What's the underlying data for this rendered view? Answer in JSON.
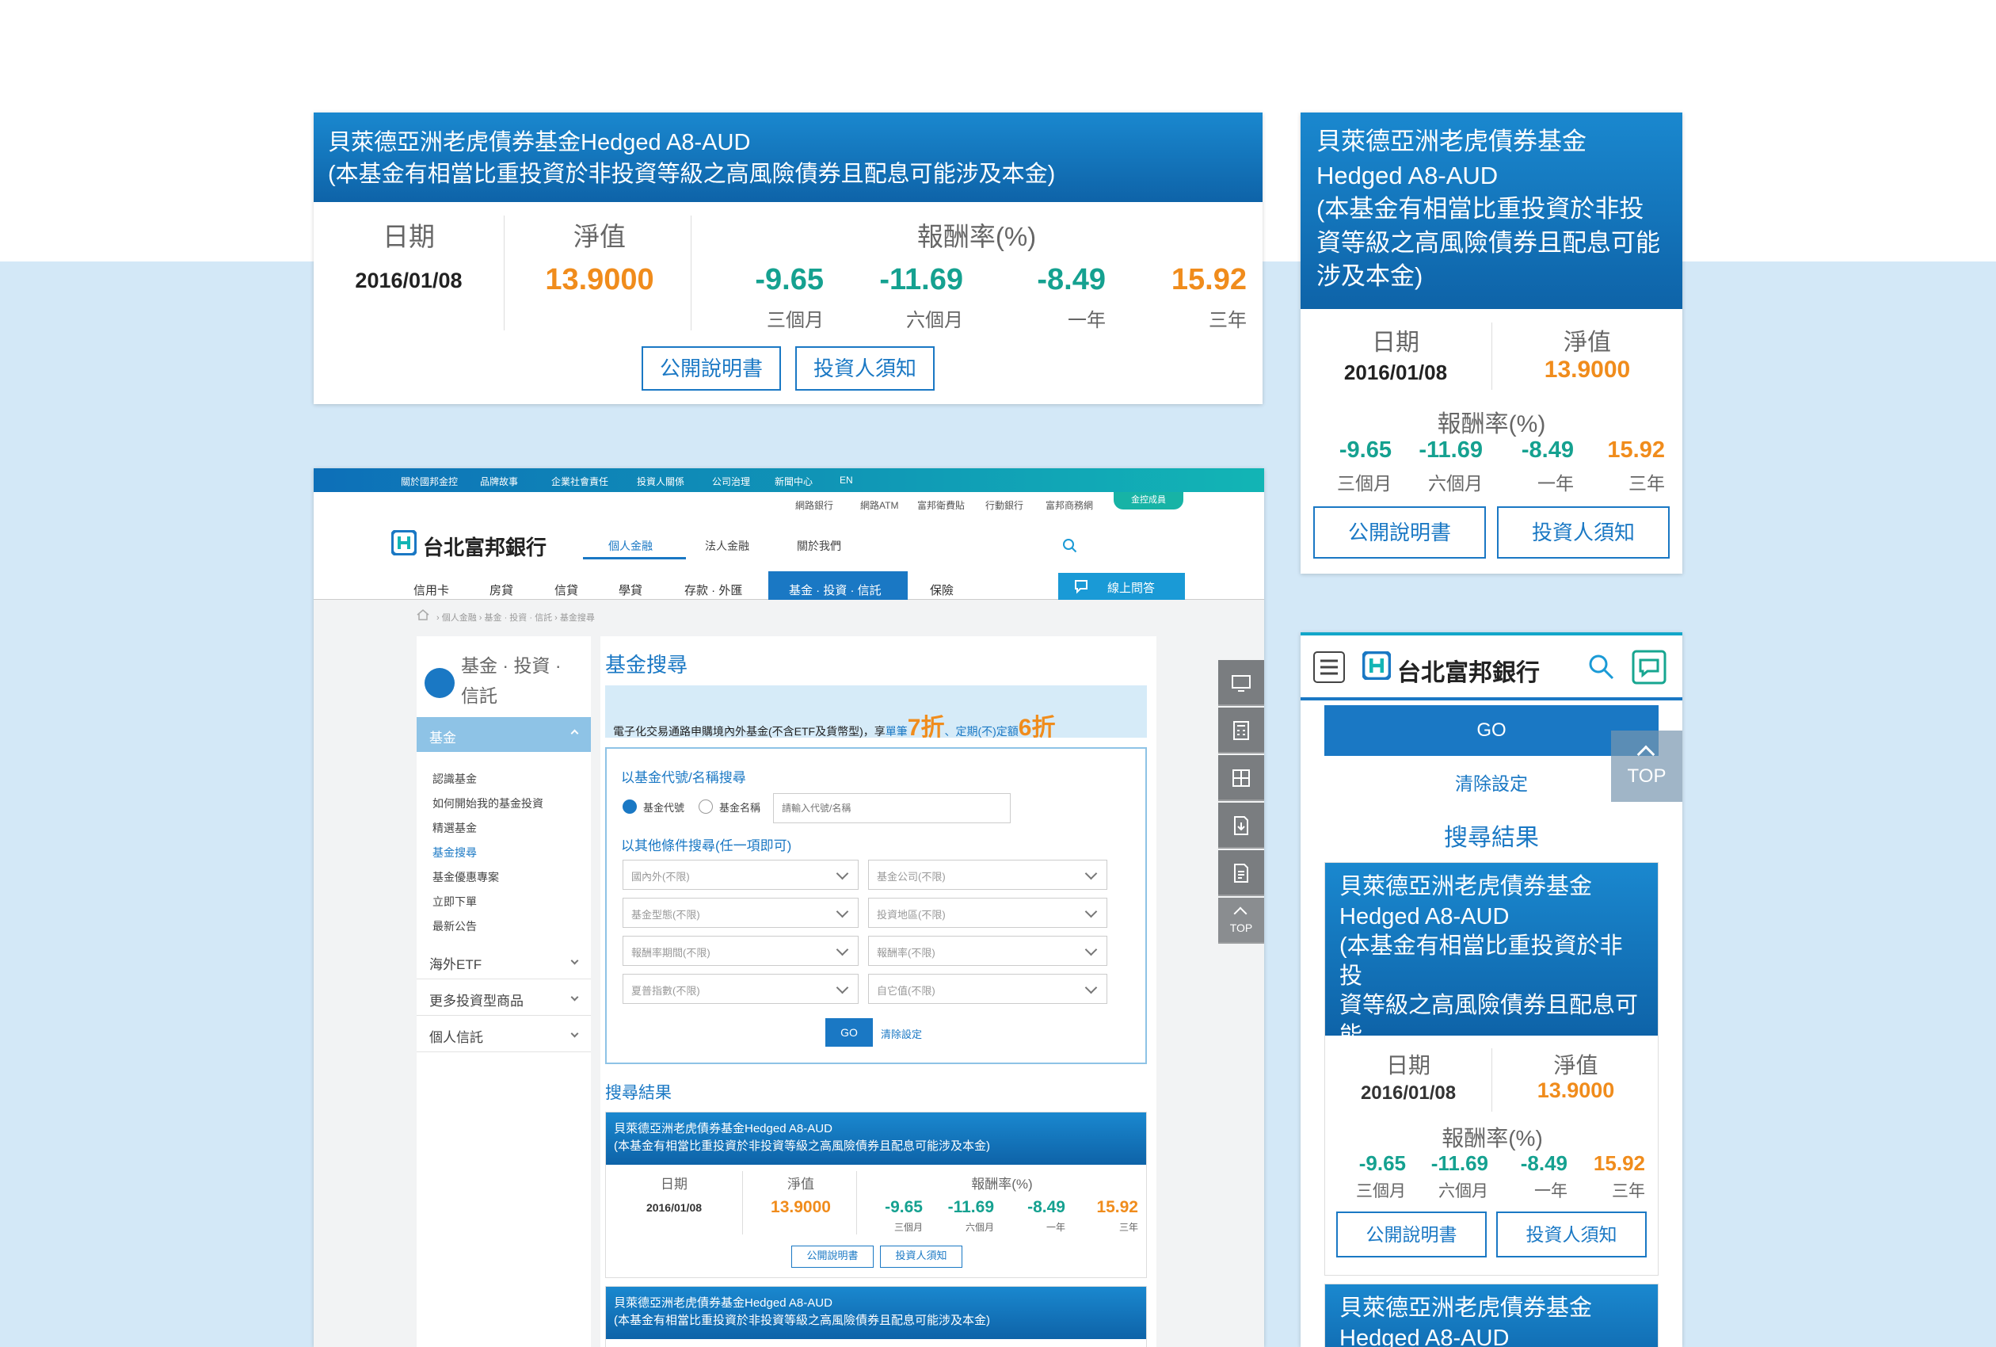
{
  "fund": {
    "name": "貝萊德亞洲老虎債券基金Hedged A8-AUD",
    "name_line1": "貝萊德亞洲老虎債券基金",
    "name_line2": "Hedged A8-AUD",
    "note": "(本基金有相當比重投資於非投資等級之高風險債券且配息可能涉及本金)",
    "note_mobile1": "(本基金有相當比重投資於非投",
    "note_mobile2": "資等級之高風險債券且配息可能",
    "note_mobile3": "涉及本金)",
    "date_label": "日期",
    "nav_label": "淨值",
    "return_label": "報酬率(%)",
    "date": "2016/01/08",
    "nav": "13.9000",
    "returns": [
      {
        "value": "-9.65",
        "period": "三個月",
        "color": "#15a190"
      },
      {
        "value": "-11.69",
        "period": "六個月",
        "color": "#15a190"
      },
      {
        "value": "-8.49",
        "period": "一年",
        "color": "#15a190"
      },
      {
        "value": "15.92",
        "period": "三年",
        "color": "#f08c1c"
      }
    ],
    "prospectus_btn": "公開說明書",
    "investor_btn": "投資人須知"
  },
  "desktop": {
    "topnav": [
      "關於國邦金控",
      "品牌故事",
      "企業社會責任",
      "投資人關係",
      "公司治理",
      "新聞中心",
      "EN"
    ],
    "utility": [
      "網路銀行",
      "網路ATM",
      "富邦衛費貼",
      "行動銀行",
      "富邦商務網"
    ],
    "member_badge": "金控成員",
    "logo_text": "台北富邦銀行",
    "main_tabs": [
      "個人金融",
      "法人金融",
      "關於我們"
    ],
    "nav": [
      "信用卡",
      "房貸",
      "信貸",
      "學貸",
      "存款 · 外匯",
      "基金 · 投資 · 信託",
      "保險"
    ],
    "online_qa": "線上問答",
    "breadcrumb": [
      "個人金融",
      "基金 · 投資 · 信託",
      "基金搜尋"
    ],
    "side_title_1": "基金 · 投資 ·",
    "side_title_2": "信託",
    "side_active": "基金",
    "side_sub": [
      "認識基金",
      "如何開始我的基金投資",
      "精選基金",
      "基金搜尋",
      "基金優惠專案",
      "立即下單",
      "最新公告"
    ],
    "side_groups": [
      "海外ETF",
      "更多投資型商品",
      "個人信託"
    ],
    "page_title": "基金搜尋",
    "promo_text": "電子化交易通路申購境內外基金(不含ETF及貨幣型)，享",
    "promo_a": "單筆",
    "promo_b": "7折",
    "promo_c": "、定期(不)定額",
    "promo_d": "6折",
    "search_by_code": "以基金代號/名稱搜尋",
    "radio_code": "基金代號",
    "radio_name": "基金名稱",
    "input_placeholder": "請輸入代號/名稱",
    "search_other": "以其他條件搜尋(任一項即可)",
    "selects": [
      "國內外(不限)",
      "基金公司(不限)",
      "基金型態(不限)",
      "投資地區(不限)",
      "報酬率期間(不限)",
      "報酬率(不限)",
      "夏普指數(不限)",
      "自它值(不限)"
    ],
    "go": "GO",
    "clear": "清除設定",
    "results_title": "搜尋結果",
    "top": "TOP"
  },
  "mobile": {
    "logo_text": "台北富邦銀行",
    "go": "GO",
    "clear": "清除設定",
    "results_title": "搜尋結果",
    "top": "TOP"
  }
}
